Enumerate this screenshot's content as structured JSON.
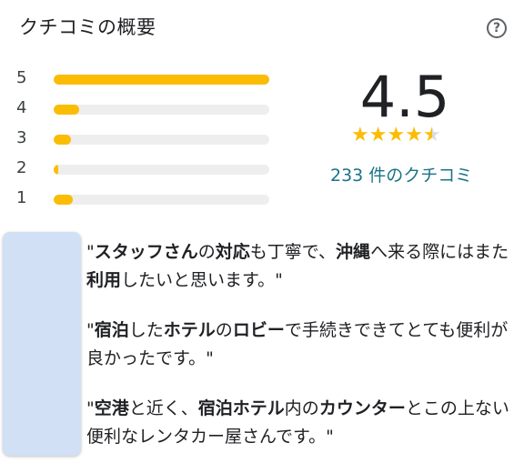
{
  "header": {
    "title": "クチコミの概要",
    "help_icon": "help-circle-icon"
  },
  "ratings": [
    {
      "label": "5",
      "fraction": 1.0
    },
    {
      "label": "4",
      "fraction": 0.12
    },
    {
      "label": "3",
      "fraction": 0.08
    },
    {
      "label": "2",
      "fraction": 0.02
    },
    {
      "label": "1",
      "fraction": 0.09
    }
  ],
  "summary": {
    "score": "4.5",
    "stars": 4.5,
    "review_count": "233 件のクチコミ"
  },
  "colors": {
    "bar": "#fbbc04",
    "track": "#eeeeee",
    "link": "#1a7388"
  },
  "quotes": [
    [
      {
        "t": "\""
      },
      {
        "t": "スタッフさん",
        "b": true
      },
      {
        "t": "の"
      },
      {
        "t": "対応",
        "b": true
      },
      {
        "t": "も丁寧で、"
      },
      {
        "t": "沖縄",
        "b": true
      },
      {
        "t": "へ来る際にはまた"
      },
      {
        "t": "利用",
        "b": true
      },
      {
        "t": "したいと思います。\""
      }
    ],
    [
      {
        "t": "\""
      },
      {
        "t": "宿泊",
        "b": true
      },
      {
        "t": "した"
      },
      {
        "t": "ホテル",
        "b": true
      },
      {
        "t": "の"
      },
      {
        "t": "ロビー",
        "b": true
      },
      {
        "t": "で手続きできてとても便利が良かったです。\""
      }
    ],
    [
      {
        "t": "\""
      },
      {
        "t": "空港",
        "b": true
      },
      {
        "t": "と近く、"
      },
      {
        "t": "宿泊ホテル",
        "b": true
      },
      {
        "t": "内の"
      },
      {
        "t": "カウンター",
        "b": true
      },
      {
        "t": "とこの上ない便利なレンタカー屋さんです。\""
      }
    ]
  ]
}
